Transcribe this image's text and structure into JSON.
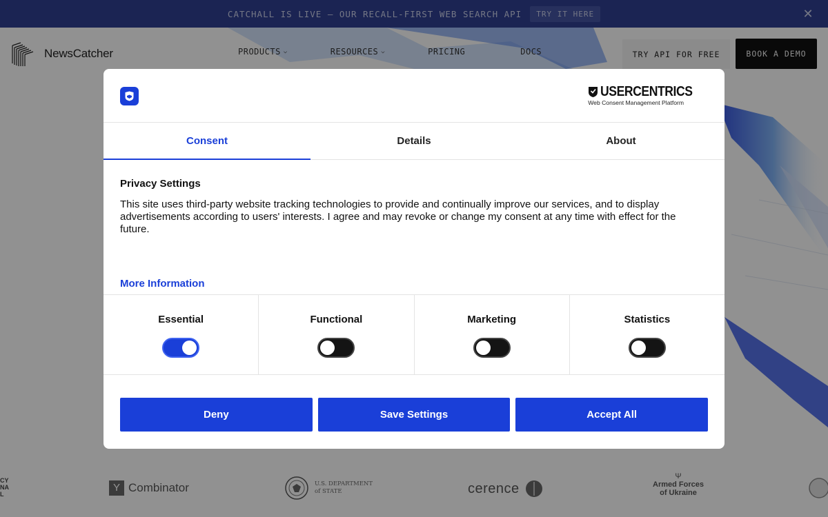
{
  "announcement": {
    "text": "CATCHALL IS LIVE — OUR RECALL-FIRST WEB SEARCH API",
    "button": "TRY IT HERE",
    "close_icon": "close-icon",
    "background": "#2f3e8f"
  },
  "navbar": {
    "brand": "NewsCatcher",
    "links": [
      {
        "label": "PRODUCTS",
        "has_dropdown": true
      },
      {
        "label": "RESOURCES",
        "has_dropdown": true
      },
      {
        "label": "PRICING",
        "has_dropdown": false
      },
      {
        "label": "DOCS",
        "has_dropdown": false
      }
    ],
    "cta_secondary": "TRY API FOR FREE",
    "cta_primary": "BOOK A DEMO"
  },
  "logos": [
    {
      "name": "partial-logo",
      "text": "CY NAL"
    },
    {
      "name": "y-combinator-logo",
      "text": "Combinator",
      "mark": "Y"
    },
    {
      "name": "us-department-of-state-logo",
      "text_line1": "U.S. DEPARTMENT",
      "text_line2": "of STATE"
    },
    {
      "name": "cerence-logo",
      "text": "cerence"
    },
    {
      "name": "armed-forces-of-ukraine-logo",
      "text_line1": "Armed Forces",
      "text_line2": "of Ukraine"
    }
  ],
  "consent_modal": {
    "brand": {
      "word": "USERCENTRICS",
      "tagline": "Web Consent Management Platform"
    },
    "tabs": [
      {
        "label": "Consent",
        "active": true
      },
      {
        "label": "Details",
        "active": false
      },
      {
        "label": "About",
        "active": false
      }
    ],
    "title": "Privacy Settings",
    "body": "This site uses third-party website tracking technologies to provide and continually improve our services, and to display advertisements according to users' interests. I agree and may revoke or change my consent at any time with effect for the future.",
    "more_info": "More Information",
    "categories": [
      {
        "label": "Essential",
        "enabled": true
      },
      {
        "label": "Functional",
        "enabled": false
      },
      {
        "label": "Marketing",
        "enabled": false
      },
      {
        "label": "Statistics",
        "enabled": false
      }
    ],
    "buttons": {
      "deny": "Deny",
      "save": "Save Settings",
      "accept": "Accept All"
    },
    "accent": "#1a3fd8"
  }
}
